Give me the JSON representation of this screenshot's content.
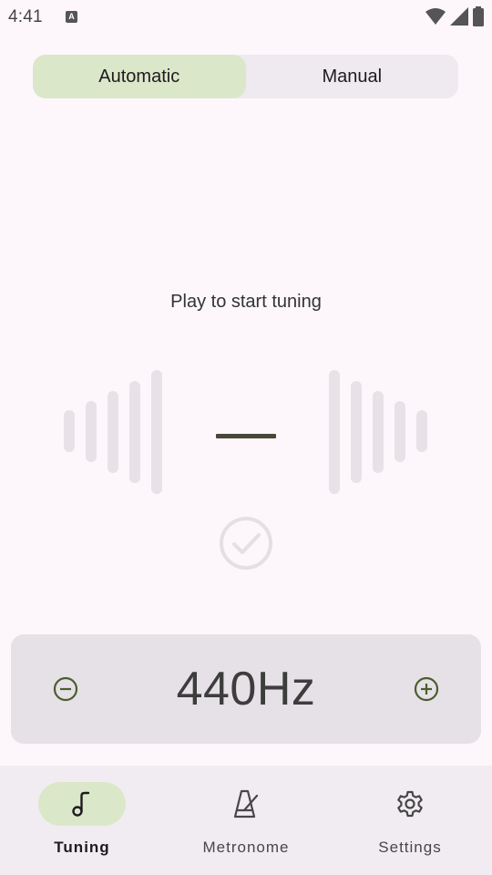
{
  "status_bar": {
    "time": "4:41",
    "notification_icon": "a-icon",
    "icons": [
      "wifi-icon",
      "signal-icon",
      "battery-icon"
    ]
  },
  "mode_selector": {
    "options": [
      {
        "label": "Automatic",
        "selected": true
      },
      {
        "label": "Manual",
        "selected": false
      }
    ],
    "selected_color": "#dbe7c9"
  },
  "tuner": {
    "hint": "Play to start tuning",
    "indicator_icon": "check-circle-icon"
  },
  "reference": {
    "value": "440Hz",
    "decrease_icon": "minus-circle-icon",
    "increase_icon": "plus-circle-icon",
    "accent_color": "#4b5e2e"
  },
  "bottom_nav": {
    "items": [
      {
        "label": "Tuning",
        "icon": "music-note-icon",
        "active": true
      },
      {
        "label": "Metronome",
        "icon": "metronome-icon",
        "active": false
      },
      {
        "label": "Settings",
        "icon": "gear-icon",
        "active": false
      }
    ]
  }
}
